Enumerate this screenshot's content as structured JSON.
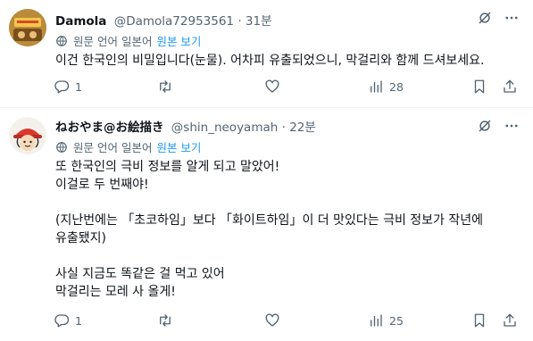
{
  "tweets": [
    {
      "name": "Damola",
      "handle": "@Damola72953561",
      "dot": "·",
      "time": "31분",
      "translation_note": "원문 언어 일본어",
      "translation_link": "원본 보기",
      "text": "이건 한국인의 비밀입니다(눈물). 어차피 유출되었으니, 막걸리와 함께 드셔보세요.",
      "replies": "1",
      "retweets": "",
      "likes": "",
      "views": "28"
    },
    {
      "name": "ねおやま@お絵描き",
      "handle": "@shin_neoyamah",
      "dot": "·",
      "time": "22분",
      "translation_note": "원문 언어 일본어",
      "translation_link": "원본 보기",
      "text": "또 한국인의 극비 정보를 알게 되고 말았어!\n이걸로 두 번째야!\n\n(지난번에는 「초코하임」보다 「화이트하임」이 더 맛있다는 극비 정보가 작년에\n유출됐지)\n\n사실 지금도 똑같은 걸 먹고 있어\n막걸리는 모레 사 올게!",
      "replies": "1",
      "retweets": "",
      "likes": "",
      "views": "25"
    }
  ],
  "icons": {
    "reply": "reply-icon",
    "retweet": "retweet-icon",
    "like": "heart-icon",
    "views": "views-icon",
    "bookmark": "bookmark-icon",
    "share": "share-icon",
    "grok": "grok-icon",
    "more": "more-icon",
    "translate": "translate-icon"
  },
  "colors": {
    "link": "#1d9bf0",
    "secondary_text": "#536471",
    "text": "#0f1419",
    "divider": "#eff3f4"
  }
}
